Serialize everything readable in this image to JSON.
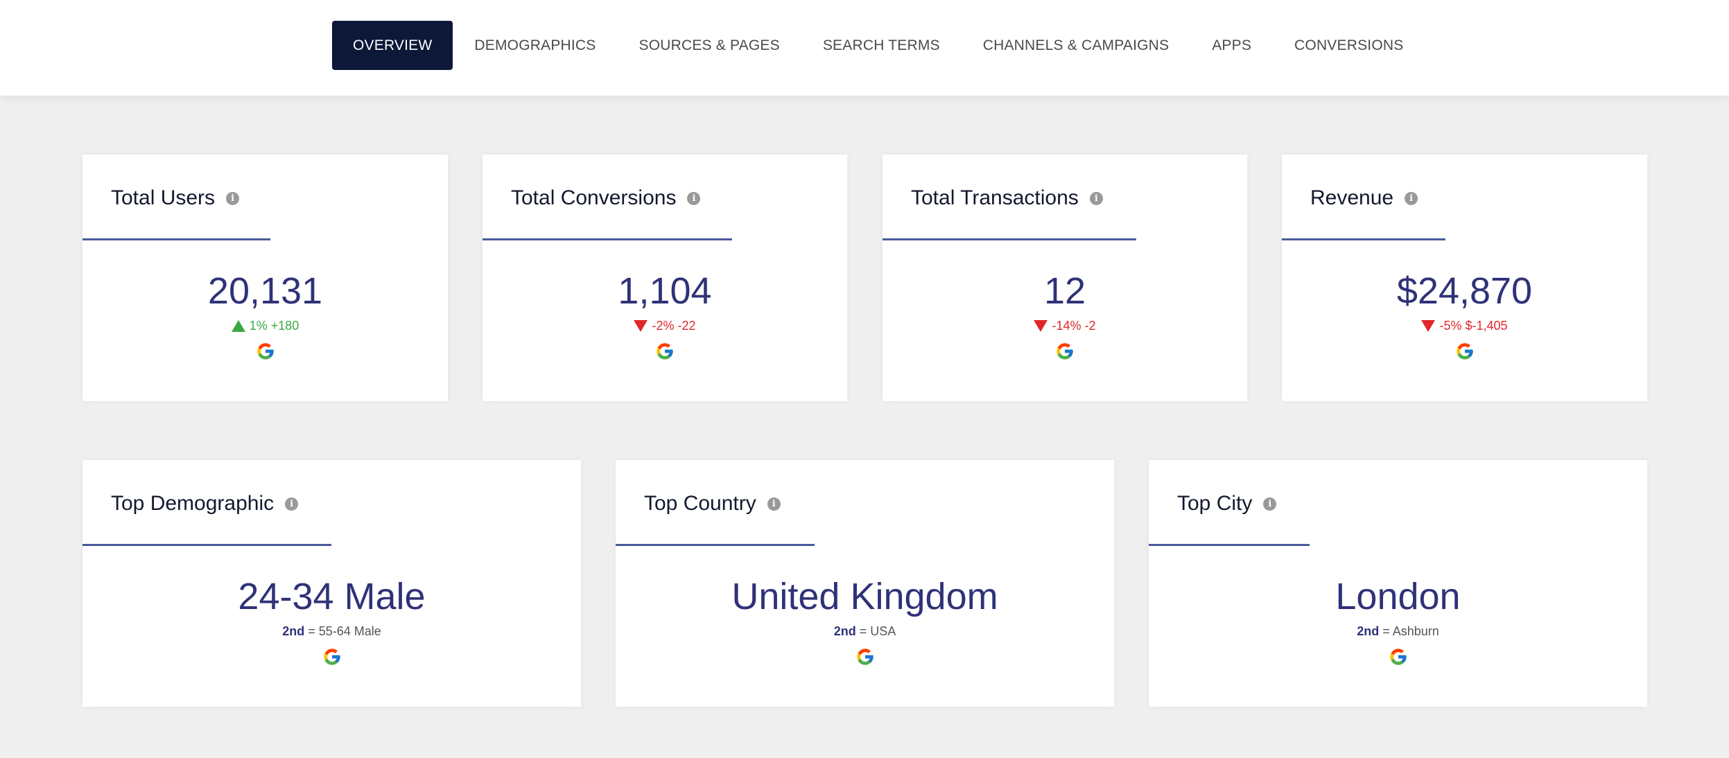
{
  "nav": {
    "tabs": [
      {
        "label": "OVERVIEW",
        "active": true
      },
      {
        "label": "DEMOGRAPHICS",
        "active": false
      },
      {
        "label": "SOURCES & PAGES",
        "active": false
      },
      {
        "label": "SEARCH TERMS",
        "active": false
      },
      {
        "label": "CHANNELS & CAMPAIGNS",
        "active": false
      },
      {
        "label": "APPS",
        "active": false
      },
      {
        "label": "CONVERSIONS",
        "active": false
      }
    ]
  },
  "kpis": [
    {
      "title": "Total Users",
      "value": "20,131",
      "direction": "up",
      "change": "1% +180",
      "source_icon": "google-icon"
    },
    {
      "title": "Total Conversions",
      "value": "1,104",
      "direction": "down",
      "change": "-2% -22",
      "source_icon": "google-icon"
    },
    {
      "title": "Total Transactions",
      "value": "12",
      "direction": "down",
      "change": "-14% -2",
      "source_icon": "google-icon"
    },
    {
      "title": "Revenue",
      "value": "$24,870",
      "direction": "down",
      "change": "-5% $-1,405",
      "source_icon": "google-icon"
    }
  ],
  "tops": [
    {
      "title": "Top Demographic",
      "value": "24-34 Male",
      "second_rank": "2nd",
      "second_value": " = 55-64 Male",
      "source_icon": "google-icon"
    },
    {
      "title": "Top Country",
      "value": "United Kingdom",
      "second_rank": "2nd",
      "second_value": " = USA",
      "source_icon": "google-icon"
    },
    {
      "title": "Top City",
      "value": "London",
      "second_rank": "2nd",
      "second_value": " = Ashburn",
      "source_icon": "google-icon"
    }
  ],
  "colors": {
    "nav_active_bg": "#0d1738",
    "value_text": "#2f3278",
    "positive": "#3aa843",
    "negative": "#e0262b",
    "rule": "#4a5a9a",
    "background": "#efefef"
  },
  "info_icon_glyph": "i"
}
